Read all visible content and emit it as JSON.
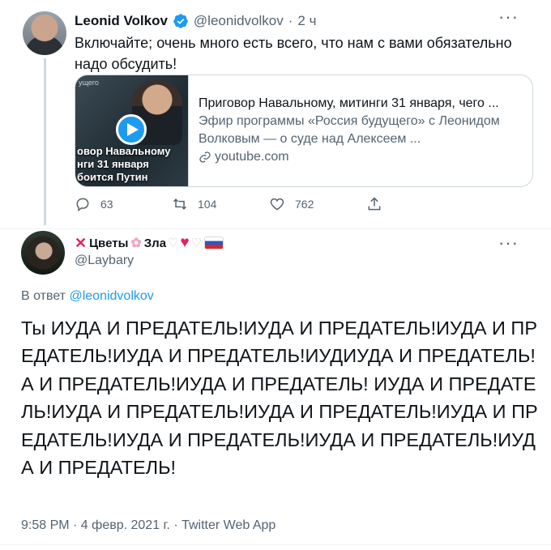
{
  "tweet": {
    "author_name": "Leonid Volkov",
    "handle": "@leonidvolkov",
    "separator": "·",
    "time": "2 ч",
    "text": "Включайте; очень много есть всего, что нам с вами обязательно надо обсудить!",
    "card": {
      "thumb_small_text": "ущего",
      "thumb_caption_line1": "овор Навальному",
      "thumb_caption_line2": "нги 31 января",
      "thumb_caption_line3": "боится Путин",
      "title": "Приговор Навальному, митинги 31 января, чего ...",
      "description": "Эфир программы «Россия будущего» с Леонидом Волковым — о суде над Алексеем ...",
      "domain": "youtube.com",
      "link_icon": "link-icon",
      "play_icon": "play-icon"
    },
    "actions": {
      "reply_count": "63",
      "retweet_count": "104",
      "like_count": "762"
    }
  },
  "reply": {
    "author_name_text": "Цветы",
    "author_name_text2": "Зла",
    "handle": "@Laybary",
    "reply_prefix": "В ответ",
    "reply_to_handle": "@leonidvolkov",
    "text": "Ты ИУДА И ПРЕДАТЕЛЬ!ИУДА И ПРЕДАТЕЛЬ!ИУДА И ПРЕДАТЕЛЬ!ИУДА И ПРЕДАТЕЛЬ!ИУДИУДА И ПРЕДАТЕЛЬ!А И ПРЕДАТЕЛЬ!ИУДА И ПРЕДАТЕЛЬ! ИУДА И ПРЕДАТЕЛЬ!ИУДА И ПРЕДАТЕЛЬ!ИУДА И ПРЕДАТЕЛЬ!ИУДА И ПРЕДАТЕЛЬ!ИУДА И ПРЕДАТЕЛЬ!ИУДА И ПРЕДАТЕЛЬ!ИУДА И ПРЕДАТЕЛЬ!",
    "meta": "9:58 PM · 4 февр. 2021 г. · Twitter Web App"
  },
  "colors": {
    "accent": "#1d9bf0",
    "secondary_text": "#536471",
    "divider": "#eff3f4"
  }
}
